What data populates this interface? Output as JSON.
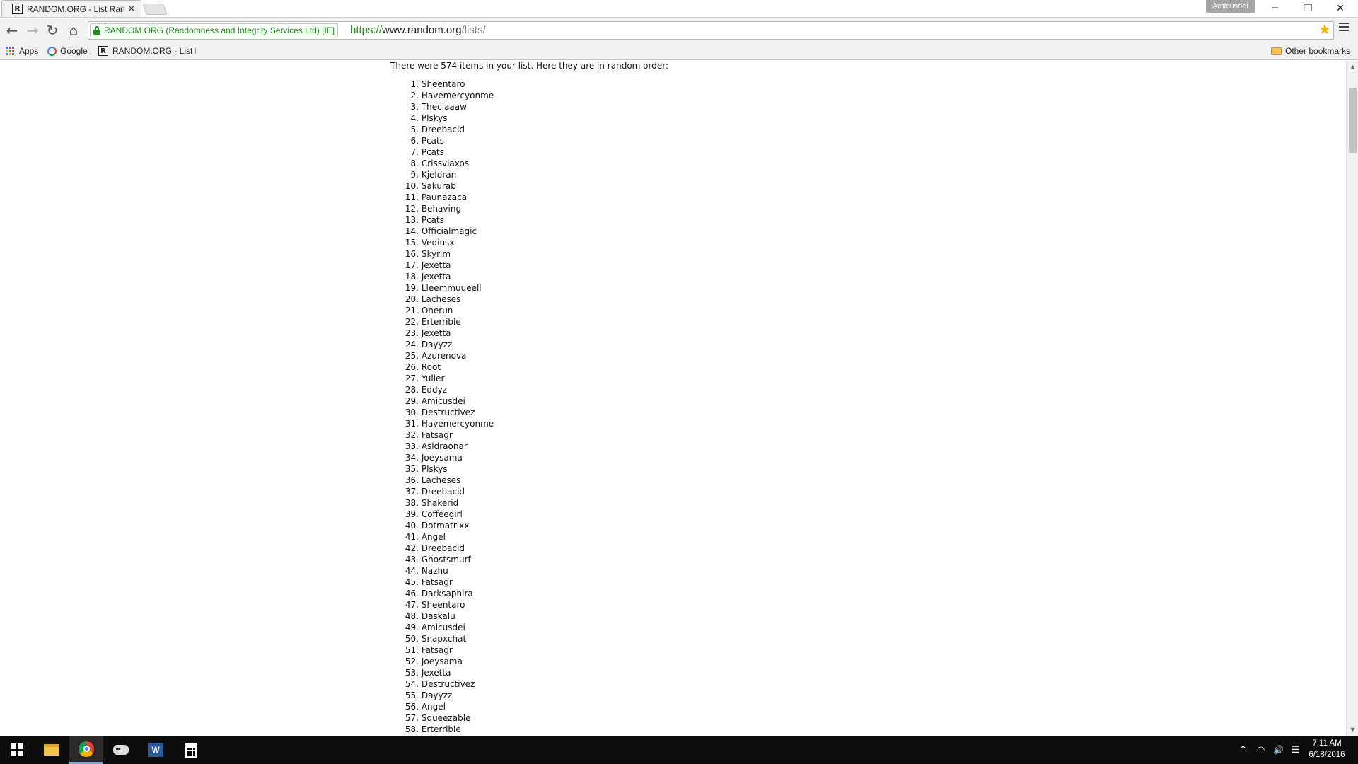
{
  "browser": {
    "tab_title": "RANDOM.ORG - List Randomizer",
    "tab_favicon_letter": "R",
    "profile_name": "Amicusdei",
    "window_controls": {
      "minimize": "─",
      "restore": "❐",
      "close": "✕"
    },
    "tab_close": "✕"
  },
  "toolbar": {
    "back": "←",
    "forward": "→",
    "reload": "↻",
    "home": "⌂",
    "security_label": "RANDOM.ORG (Randomness and Integrity Services Ltd) [IE]",
    "url_scheme": "https://",
    "url_host": "www.random.org",
    "url_path": "/lists/",
    "bookmark_star": "★",
    "accent_color": "#1b8c1b"
  },
  "bookmarks": {
    "apps_label": "Apps",
    "google_label": "Google",
    "random_label": "RANDOM.ORG - List Ra",
    "other_label": "Other bookmarks"
  },
  "page": {
    "intro": "There were 574 items in your list. Here they are in random order:",
    "items": [
      {
        "n": "1.",
        "t": "Sheentaro"
      },
      {
        "n": "2.",
        "t": "Havemercyonme"
      },
      {
        "n": "3.",
        "t": "Theclaaaw"
      },
      {
        "n": "4.",
        "t": "Plskys"
      },
      {
        "n": "5.",
        "t": "Dreebacid"
      },
      {
        "n": "6.",
        "t": "Pcats"
      },
      {
        "n": "7.",
        "t": "Pcats"
      },
      {
        "n": "8.",
        "t": "Crissvlaxos"
      },
      {
        "n": "9.",
        "t": "Kjeldran"
      },
      {
        "n": "10.",
        "t": "Sakurab"
      },
      {
        "n": "11.",
        "t": "Paunazaca"
      },
      {
        "n": "12.",
        "t": "Behaving"
      },
      {
        "n": "13.",
        "t": "Pcats"
      },
      {
        "n": "14.",
        "t": "Officialmagic"
      },
      {
        "n": "15.",
        "t": "Vediusx"
      },
      {
        "n": "16.",
        "t": "Skyrim"
      },
      {
        "n": "17.",
        "t": "Jexetta"
      },
      {
        "n": "18.",
        "t": "Jexetta"
      },
      {
        "n": "19.",
        "t": "Lleemmuueell"
      },
      {
        "n": "20.",
        "t": "Lacheses"
      },
      {
        "n": "21.",
        "t": "Onerun"
      },
      {
        "n": "22.",
        "t": "Erterrible"
      },
      {
        "n": "23.",
        "t": "Jexetta"
      },
      {
        "n": "24.",
        "t": "Dayyzz"
      },
      {
        "n": "25.",
        "t": "Azurenova"
      },
      {
        "n": "26.",
        "t": "Root"
      },
      {
        "n": "27.",
        "t": "Yulier"
      },
      {
        "n": "28.",
        "t": "Eddyz"
      },
      {
        "n": "29.",
        "t": "Amicusdei"
      },
      {
        "n": "30.",
        "t": "Destructivez"
      },
      {
        "n": "31.",
        "t": "Havemercyonme"
      },
      {
        "n": "32.",
        "t": "Fatsagr"
      },
      {
        "n": "33.",
        "t": "Asidraonar"
      },
      {
        "n": "34.",
        "t": "Joeysama"
      },
      {
        "n": "35.",
        "t": "Plskys"
      },
      {
        "n": "36.",
        "t": "Lacheses"
      },
      {
        "n": "37.",
        "t": "Dreebacid"
      },
      {
        "n": "38.",
        "t": "Shakerid"
      },
      {
        "n": "39.",
        "t": "Coffeegirl"
      },
      {
        "n": "40.",
        "t": "Dotmatrixx"
      },
      {
        "n": "41.",
        "t": "Angel"
      },
      {
        "n": "42.",
        "t": "Dreebacid"
      },
      {
        "n": "43.",
        "t": "Ghostsmurf"
      },
      {
        "n": "44.",
        "t": "Nazhu"
      },
      {
        "n": "45.",
        "t": "Fatsagr"
      },
      {
        "n": "46.",
        "t": "Darksaphira"
      },
      {
        "n": "47.",
        "t": "Sheentaro"
      },
      {
        "n": "48.",
        "t": "Daskalu"
      },
      {
        "n": "49.",
        "t": "Amicusdei"
      },
      {
        "n": "50.",
        "t": "Snapxchat"
      },
      {
        "n": "51.",
        "t": "Fatsagr"
      },
      {
        "n": "52.",
        "t": "Joeysama"
      },
      {
        "n": "53.",
        "t": "Jexetta"
      },
      {
        "n": "54.",
        "t": "Destructivez"
      },
      {
        "n": "55.",
        "t": "Dayyzz"
      },
      {
        "n": "56.",
        "t": "Angel"
      },
      {
        "n": "57.",
        "t": "Squeezable"
      },
      {
        "n": "58.",
        "t": "Erterrible"
      }
    ]
  },
  "taskbar": {
    "icons": [
      "windows-start-icon",
      "file-explorer-icon",
      "chrome-icon",
      "game-controller-icon",
      "word-icon",
      "calculator-icon"
    ],
    "tray_up": "^",
    "tray_network": "◠",
    "tray_volume": "🔊",
    "tray_notifications": "☰",
    "time": "7:11 AM",
    "date": "6/18/2016"
  }
}
